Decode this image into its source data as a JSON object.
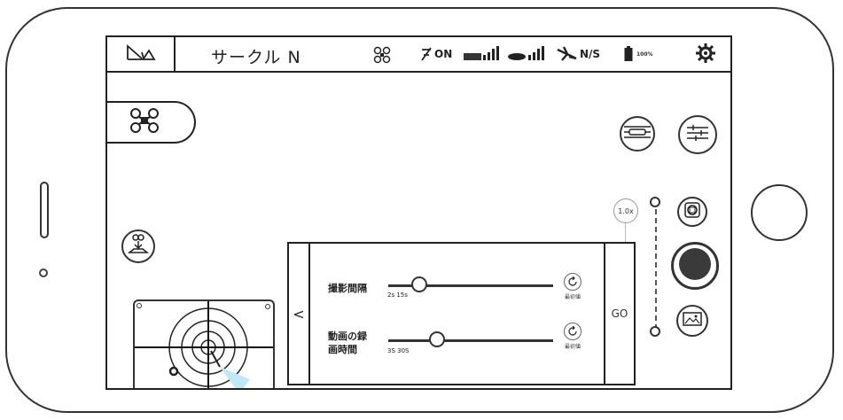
{
  "header": {
    "title": "サークル N"
  },
  "status": {
    "gps_label": "ON",
    "direction_label": "N/S",
    "battery_label": "100%"
  },
  "zoom": {
    "level": "1.0x"
  },
  "panel": {
    "row1": {
      "label_line1": "撮影間隔",
      "range": "2s 15s",
      "reset_label": "最初値"
    },
    "row2": {
      "label_line1": "動画の録",
      "label_line2": "画時間",
      "range": "3S 30S",
      "reset_label": "最初値"
    },
    "back_symbol": "<",
    "go_label": "GO"
  },
  "icons": {
    "logo": "logo-icon",
    "drone": "drone-icon",
    "gps": "gps-icon",
    "signal": "signal-icon",
    "controller": "controller-signal-icon",
    "direction": "plane-direction-icon",
    "battery": "battery-icon",
    "settings": "gear-icon",
    "vr": "vr-icon",
    "adjust": "sliders-icon",
    "landing": "landing-icon",
    "photo": "photo-icon",
    "record": "record-button-icon",
    "gallery": "gallery-icon",
    "reset": "reset-icon",
    "joystick": "joystick-icon"
  }
}
